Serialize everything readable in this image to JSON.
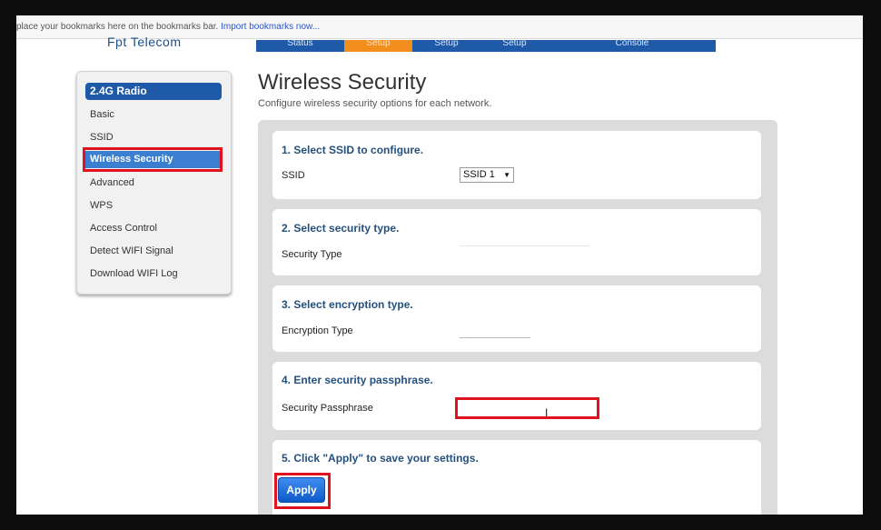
{
  "bookmarks_bar": {
    "message": "place your bookmarks here on the bookmarks bar.",
    "import_link": "Import bookmarks now..."
  },
  "header": {
    "brand": "Fpt Telecom",
    "nav_tabs": [
      {
        "label": "Status",
        "active": false
      },
      {
        "label": "Setup",
        "active": true
      },
      {
        "label": "Setup",
        "active": false
      },
      {
        "label": "Setup",
        "active": false
      },
      {
        "label": "Console",
        "active": false
      }
    ]
  },
  "sidebar": {
    "title": "2.4G Radio",
    "items": [
      {
        "label": "Basic",
        "active": false
      },
      {
        "label": "SSID",
        "active": false
      },
      {
        "label": "Wireless Security",
        "active": true
      },
      {
        "label": "Advanced",
        "active": false
      },
      {
        "label": "WPS",
        "active": false
      },
      {
        "label": "Access Control",
        "active": false
      },
      {
        "label": "Detect WIFI Signal",
        "active": false
      },
      {
        "label": "Download WIFI Log",
        "active": false
      }
    ]
  },
  "page": {
    "title": "Wireless Security",
    "subtitle": "Configure wireless security options for each network."
  },
  "sections": {
    "ssid": {
      "title": "1. Select SSID to configure.",
      "label": "SSID",
      "value": "SSID 1"
    },
    "security_type": {
      "title": "2. Select security type.",
      "label": "Security Type"
    },
    "encryption": {
      "title": "3. Select encryption type.",
      "label": "Encryption Type"
    },
    "passphrase": {
      "title": "4. Enter security passphrase.",
      "label": "Security Passphrase",
      "value": ""
    },
    "apply": {
      "title": "5. Click \"Apply\" to save your settings.",
      "button_label": "Apply"
    }
  },
  "colors": {
    "nav_blue": "#1e5aa8",
    "nav_active_orange": "#f28e1c",
    "highlight_red": "#e0121f",
    "section_title_blue": "#24507e"
  }
}
